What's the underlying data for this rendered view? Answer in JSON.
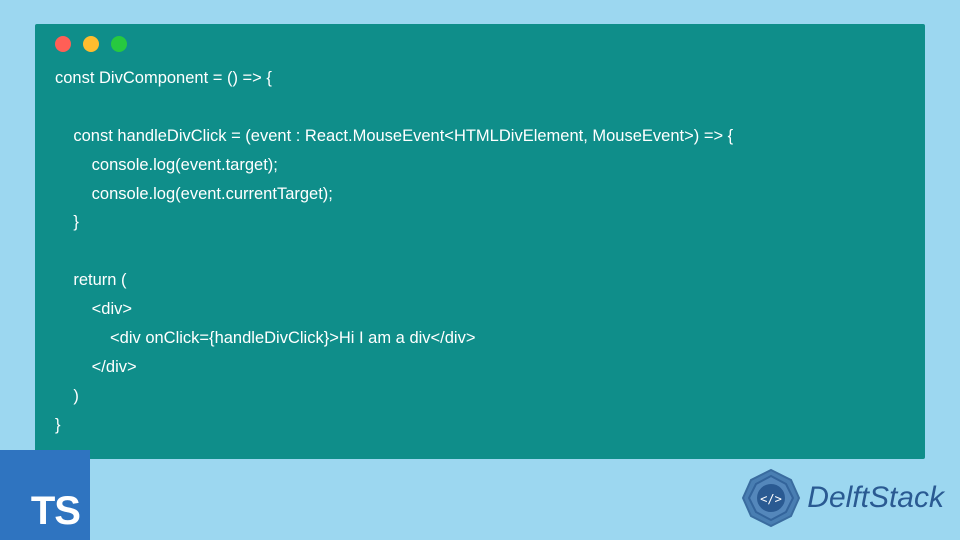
{
  "code": {
    "lines": [
      "const DivComponent = () => {",
      "",
      "    const handleDivClick = (event : React.MouseEvent<HTMLDivElement, MouseEvent>) => {",
      "        console.log(event.target);",
      "        console.log(event.currentTarget);",
      "    }",
      "",
      "    return (",
      "        <div>",
      "            <div onClick={handleDivClick}>Hi I am a div</div>",
      "        </div>",
      "    )",
      "}"
    ]
  },
  "tsBadge": {
    "label": "TS"
  },
  "brand": {
    "name": "DelftStack"
  },
  "colors": {
    "pageBg": "#9cd7f0",
    "windowBg": "#0f8e8a",
    "tsBadgeBg": "#2f74c0",
    "brandText": "#2a5a92",
    "codeText": "#ffffff",
    "dotRed": "#ff5f56",
    "dotYellow": "#ffbd2e",
    "dotGreen": "#27c93f"
  }
}
